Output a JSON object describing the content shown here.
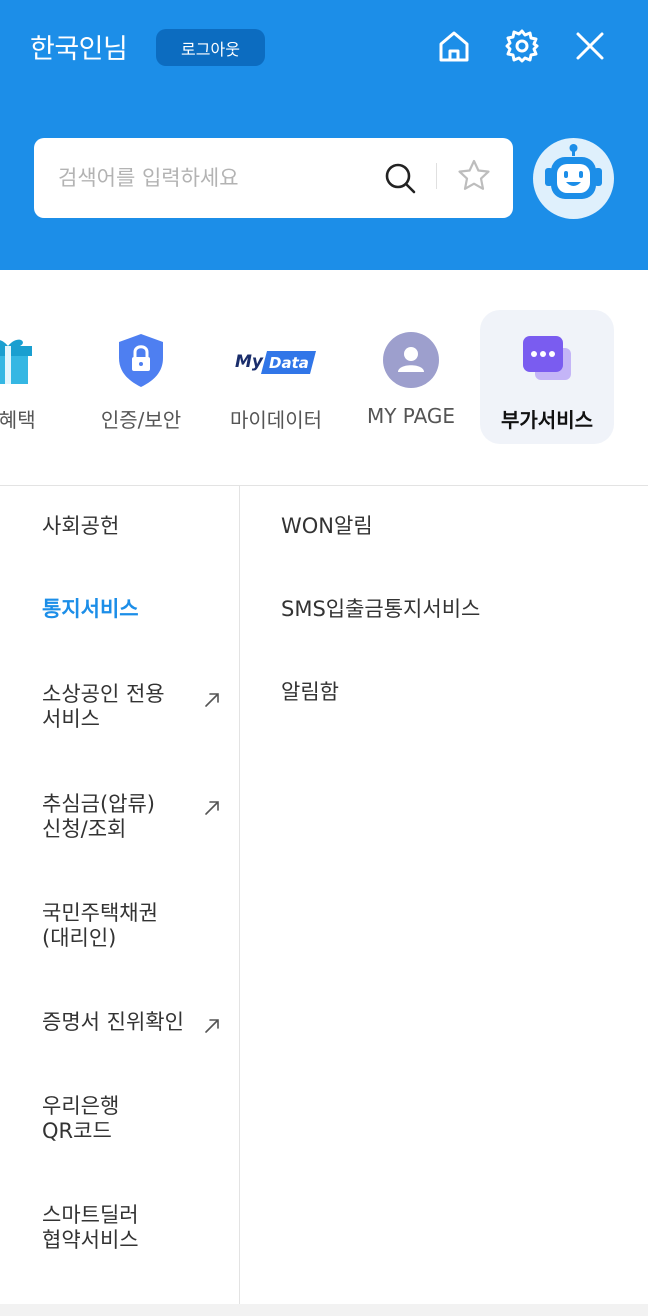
{
  "header": {
    "user_name": "한국인님",
    "logout_label": "로그아웃",
    "icons": [
      "home-icon",
      "gear-icon",
      "close-icon"
    ],
    "background": "#1c8ee8"
  },
  "search": {
    "placeholder": "검색어를 입력하세요",
    "value": ""
  },
  "categories": [
    {
      "label": "할혜택",
      "icon": "gift-icon"
    },
    {
      "label": "인증/보안",
      "icon": "shield-lock-icon"
    },
    {
      "label": "마이데이터",
      "icon": "mydata-logo-icon",
      "logo_text": "My Data"
    },
    {
      "label": "MY PAGE",
      "icon": "user-icon"
    },
    {
      "label": "부가서비스",
      "icon": "chat-bubble-icon",
      "active": true
    }
  ],
  "side_menu": [
    {
      "line1": "사회공헌",
      "line2": "",
      "external": false
    },
    {
      "line1": "통지서비스",
      "line2": "",
      "external": false,
      "active": true
    },
    {
      "line1": "소상공인 전용",
      "line2": "서비스",
      "external": true
    },
    {
      "line1": "추심금(압류)",
      "line2": "신청/조회",
      "external": true
    },
    {
      "line1": "국민주택채권",
      "line2": "(대리인)",
      "external": false
    },
    {
      "line1": "증명서 진위확인",
      "line2": "",
      "external": true
    },
    {
      "line1": "우리은행",
      "line2": "QR코드",
      "external": false
    },
    {
      "line1": "스마트딜러",
      "line2": "협약서비스",
      "external": false
    }
  ],
  "sub_menu": [
    {
      "label": "WON알림"
    },
    {
      "label": "SMS입출금통지서비스"
    },
    {
      "label": "알림함"
    }
  ],
  "colors": {
    "accent": "#1c8ee8",
    "logout_bg": "#0c6cc0",
    "active_tile_bg": "#f0f3f9"
  }
}
